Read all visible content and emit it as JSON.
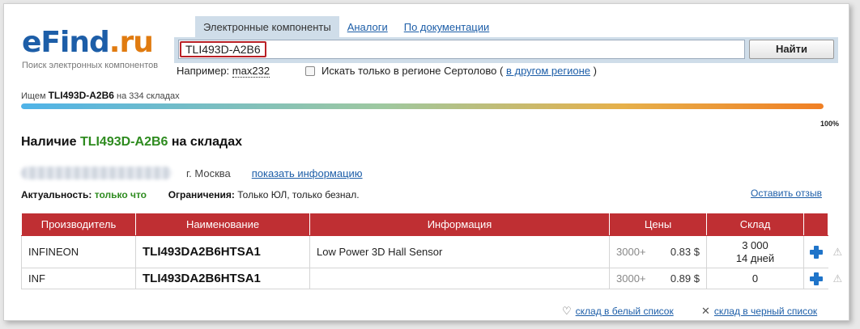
{
  "logo": {
    "e": "e",
    "find": "Find",
    "dot": ".",
    "ru": "ru",
    "subtitle": "Поиск электронных компонентов"
  },
  "tabs": {
    "active": "Электронные компоненты",
    "analogs": "Аналоги",
    "docs": "По документации"
  },
  "search": {
    "value": "TLI493D-A2B6",
    "button": "Найти"
  },
  "example": {
    "label": "Например:",
    "value": "max232"
  },
  "region": {
    "checkbox_label": "Искать только в регионе Сертолово",
    "open": "(",
    "link": "в другом регионе",
    "close": ")"
  },
  "status": {
    "prefix": "Ищем",
    "part": "TLI493D-A2B6",
    "suffix": "на 334 складах",
    "progress_percent": 100,
    "progress_label": "100%"
  },
  "availability": {
    "prefix": "Наличие",
    "part": "TLI493D-A2B6",
    "suffix": "на складах"
  },
  "seller": {
    "city": "г. Москва",
    "info_link": "показать информацию"
  },
  "freshness": {
    "label": "Актуальность:",
    "value": "только что",
    "restrictions_label": "Ограничения:",
    "restrictions_value": "Только ЮЛ, только безнал."
  },
  "review_link": "Оставить отзыв",
  "table": {
    "headers": {
      "manufacturer": "Производитель",
      "name": "Наименование",
      "info": "Информация",
      "price": "Цены",
      "stock": "Склад"
    },
    "rows": [
      {
        "manufacturer": "INFINEON",
        "name": "TLI493DA2B6HTSA1",
        "info": "Low Power 3D Hall Sensor",
        "price_qty": "3000+",
        "price": "0.83 $",
        "stock": "3 000",
        "stock_note": "14 дней"
      },
      {
        "manufacturer": "INF",
        "name": "TLI493DA2B6HTSA1",
        "info": "",
        "price_qty": "3000+",
        "price": "0.89 $",
        "stock": "0",
        "stock_note": ""
      }
    ]
  },
  "footer": {
    "whitelist": "склад в белый список",
    "blacklist": "склад в черный список"
  },
  "colors": {
    "brand_blue": "#1d5ea8",
    "brand_orange": "#e07b10",
    "header_red": "#bf2f33",
    "green": "#2e8b1f"
  }
}
